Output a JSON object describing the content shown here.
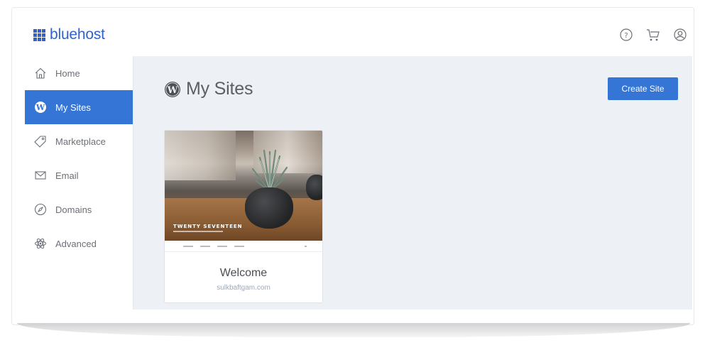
{
  "header": {
    "logo_text": "bluehost",
    "icons": [
      "help-icon",
      "cart-icon",
      "account-icon"
    ]
  },
  "sidebar": {
    "items": [
      {
        "label": "Home",
        "icon": "home-icon",
        "active": false
      },
      {
        "label": "My Sites",
        "icon": "wordpress-icon",
        "active": true
      },
      {
        "label": "Marketplace",
        "icon": "tag-icon",
        "active": false
      },
      {
        "label": "Email",
        "icon": "mail-icon",
        "active": false
      },
      {
        "label": "Domains",
        "icon": "compass-icon",
        "active": false
      },
      {
        "label": "Advanced",
        "icon": "atom-icon",
        "active": false
      }
    ]
  },
  "main": {
    "title": "My Sites",
    "create_button": "Create Site",
    "sites": [
      {
        "theme_name": "TWENTY SEVENTEEN",
        "title": "Welcome",
        "url": "sulkbaftgam.com"
      }
    ]
  },
  "colors": {
    "brand": "#3064c8",
    "accent": "#3575d6",
    "main_bg": "#edf1f5"
  }
}
